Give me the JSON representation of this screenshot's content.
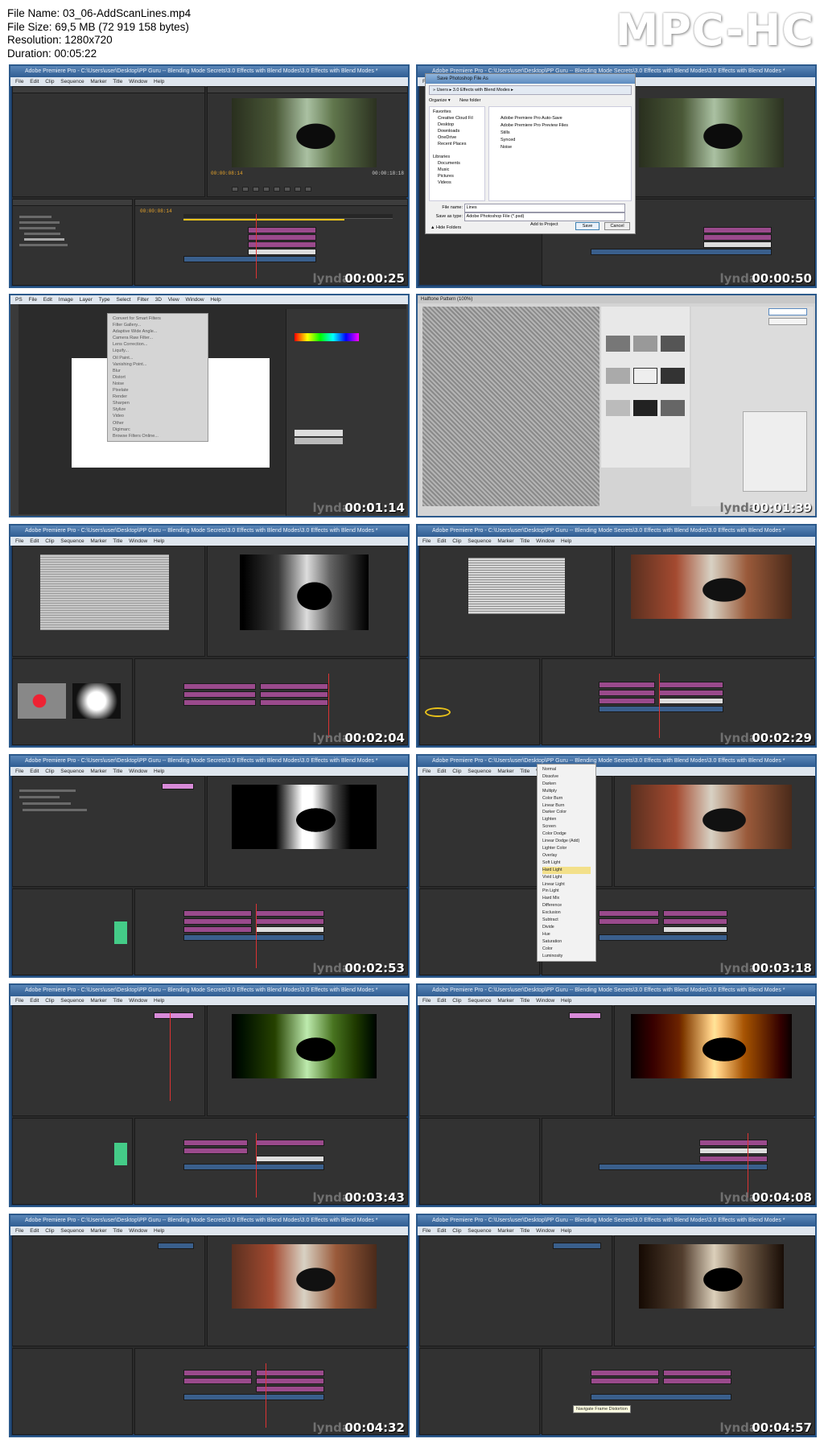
{
  "file_info": {
    "file_name": "File Name: 03_06-AddScanLines.mp4",
    "file_size": "File Size: 69,5 MB (72 919 158 bytes)",
    "resolution": "Resolution: 1280x720",
    "duration": "Duration: 00:05:22"
  },
  "brand": "MPC-HC",
  "watermark": "lynda",
  "window_title": "Adobe Premiere Pro - C:\\Users\\user\\Desktop\\PP Guru -- Blending Mode Secrets\\3.0 Effects with Blend Modes\\3.0 Effects with Blend Modes *",
  "menu_bar": "File Edit Clip Sequence Marker Title Window Help",
  "ps_menu_bar": "PS File Edit Image Layer Type Select Filter 3D View Window Help",
  "save_dialog": {
    "title": "Save Photoshop File As",
    "organize": "Organize ▾",
    "new_folder": "New folder",
    "favorites": [
      "Favorites",
      "Creative Cloud Fil",
      "Desktop",
      "Downloads",
      "OneDrive",
      "Recent Places"
    ],
    "libraries": [
      "Libraries",
      "Documents",
      "Music",
      "Pictures",
      "Videos"
    ],
    "files": [
      "Adobe Premiere Pro Auto-Save",
      "Adobe Premiere Pro Preview Files",
      "Stills",
      "Synced",
      "Noise"
    ],
    "file_name_label": "File name:",
    "file_name_value": "Lines",
    "save_type_label": "Save as type:",
    "save_type_value": "Adobe Photoshop File (*.psd)",
    "hide_folders": "▲ Hide Folders",
    "add_to_project": "Add to Project",
    "save_button": "Save",
    "cancel_button": "Cancel"
  },
  "filter_menu": [
    "Convert for Smart Filters",
    "Filter Gallery...",
    "Adaptive Wide Angle...",
    "Camera Raw Filter...",
    "Lens Correction...",
    "Liquify...",
    "Oil Paint...",
    "Vanishing Point...",
    "Blur",
    "Distort",
    "Noise",
    "Pixelate",
    "Render",
    "Sharpen",
    "Stylize",
    "Video",
    "Other",
    "Digimarc",
    "Browse Filters Online..."
  ],
  "filter_gallery_title": "Halftone Pattern (100%)",
  "blend_menu": [
    "Normal",
    "Dissolve",
    "Darken",
    "Multiply",
    "Color Burn",
    "Linear Burn",
    "Darker Color",
    "Lighten",
    "Screen",
    "Color Dodge",
    "Linear Dodge (Add)",
    "Lighter Color",
    "Overlay",
    "Soft Light",
    "Hard Light",
    "Vivid Light",
    "Linear Light",
    "Pin Light",
    "Hard Mix",
    "Difference",
    "Exclusion",
    "Subtract",
    "Divide",
    "Hue",
    "Saturation",
    "Color",
    "Luminosity"
  ],
  "tooltip": "Navigate Frame Distortion",
  "frames": [
    {
      "timestamp": "00:00:25"
    },
    {
      "timestamp": "00:00:50"
    },
    {
      "timestamp": "00:01:14"
    },
    {
      "timestamp": "00:01:39"
    },
    {
      "timestamp": "00:02:04"
    },
    {
      "timestamp": "00:02:29"
    },
    {
      "timestamp": "00:02:53"
    },
    {
      "timestamp": "00:03:18"
    },
    {
      "timestamp": "00:03:43"
    },
    {
      "timestamp": "00:04:08"
    },
    {
      "timestamp": "00:04:32"
    },
    {
      "timestamp": "00:04:57"
    }
  ]
}
